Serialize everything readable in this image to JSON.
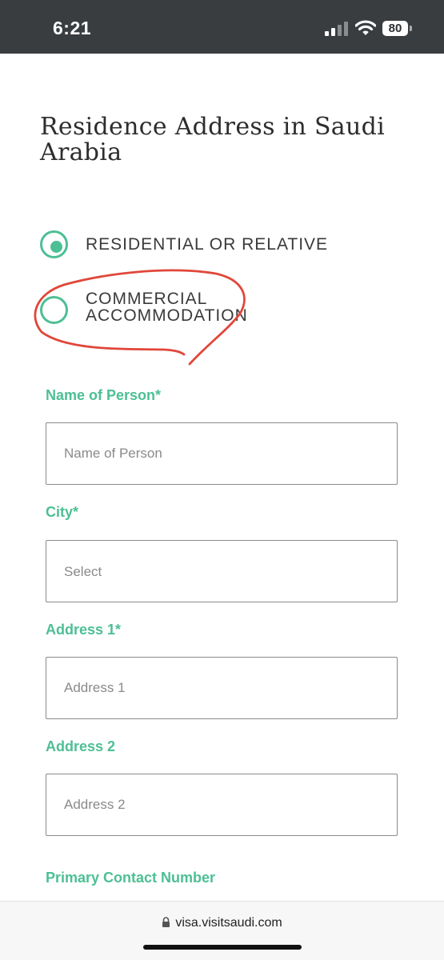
{
  "status_bar": {
    "time": "6:21",
    "battery": "80",
    "icons": [
      "cellular-signal-icon",
      "wifi-icon",
      "battery-icon"
    ]
  },
  "form": {
    "title": "Residence Address in Saudi Arabia",
    "accommodation_options": [
      {
        "label": "RESIDENTIAL OR RELATIVE",
        "selected": true
      },
      {
        "label": "COMMERCIAL ACCOMMODATION",
        "selected": false
      }
    ],
    "fields": {
      "name_of_person": {
        "label": "Name of Person*",
        "placeholder": "Name of Person",
        "value": ""
      },
      "city": {
        "label": "City*",
        "placeholder": "Select",
        "value": ""
      },
      "address1": {
        "label": "Address 1*",
        "placeholder": "Address 1",
        "value": ""
      },
      "address2": {
        "label": "Address 2",
        "placeholder": "Address 2",
        "value": ""
      },
      "primary_contact": {
        "label": "Primary Contact Number"
      }
    }
  },
  "browser": {
    "url": "visa.visitsaudi.com",
    "icons": [
      "lock-icon"
    ]
  },
  "colors": {
    "accent": "#4dbf94",
    "status_bar": "#3a3d40",
    "annotation": "#e0473a",
    "title_text": "#2d2d2d"
  }
}
